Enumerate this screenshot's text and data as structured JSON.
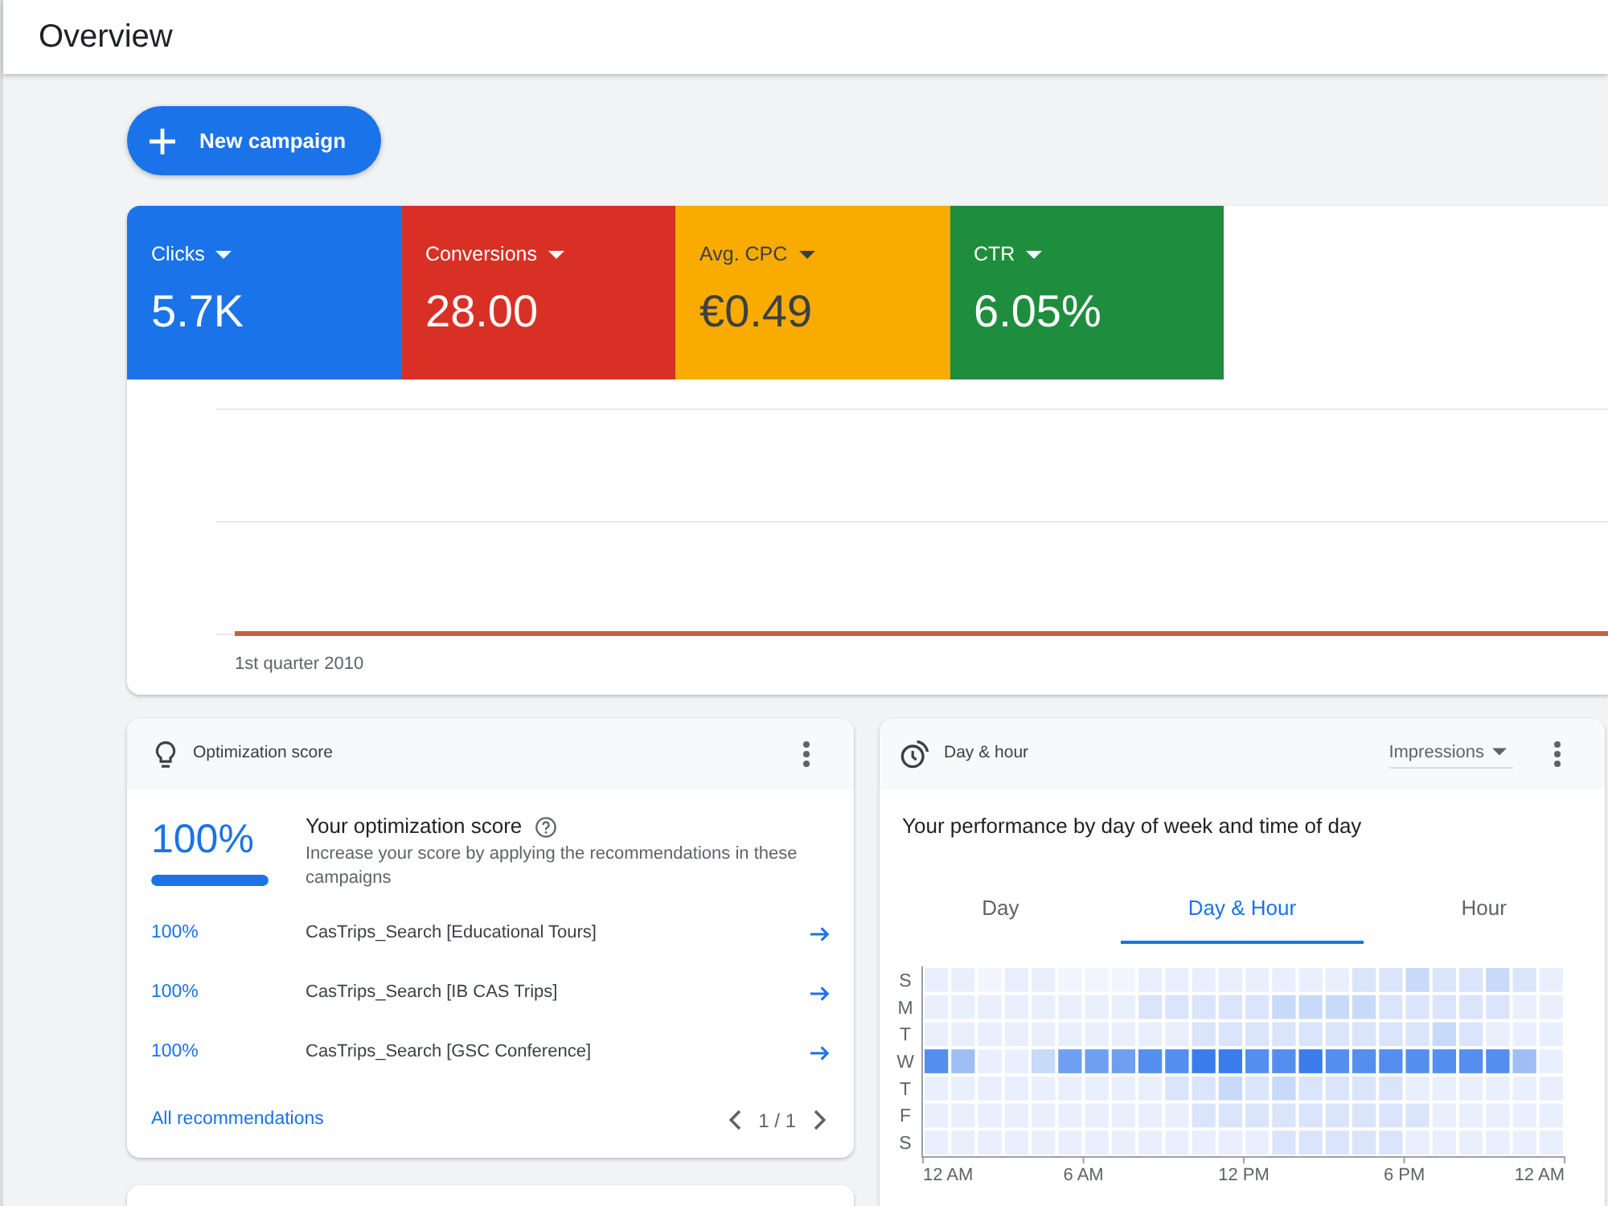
{
  "header": {
    "title": "Overview"
  },
  "new_campaign_button": {
    "label": "New campaign"
  },
  "overview": {
    "metrics": [
      {
        "label": "Clicks",
        "value": "5.7K",
        "color": "#1a73e8"
      },
      {
        "label": "Conversions",
        "value": "28.00",
        "color": "#d93025"
      },
      {
        "label": "Avg. CPC",
        "value": "€0.49",
        "color": "#f9ab00"
      },
      {
        "label": "CTR",
        "value": "6.05%",
        "color": "#1e8e3e"
      }
    ],
    "chart": {
      "x_label": "1st quarter 2010"
    }
  },
  "optimization_card": {
    "title": "Optimization score",
    "score": "100%",
    "level": 1,
    "heading": "Your optimization score",
    "description": "Increase your score by applying the recommendations in these campaigns",
    "campaigns": [
      {
        "score": "100%",
        "name": "CasTrips_Search [Educational Tours]"
      },
      {
        "score": "100%",
        "name": "CasTrips_Search [IB CAS Trips]"
      },
      {
        "score": "100%",
        "name": "CasTrips_Search [GSC Conference]"
      }
    ],
    "link": "All recommendations",
    "pagination": "1 / 1"
  },
  "day_hour_card": {
    "title": "Day & hour",
    "metric": "Impressions",
    "heading": "Your performance by day of week and time of day",
    "tabs": [
      {
        "label": "Day",
        "selected": false
      },
      {
        "label": "Day & Hour",
        "selected": true
      },
      {
        "label": "Hour",
        "selected": false
      }
    ],
    "heatmap": {
      "days": [
        "S",
        "M",
        "T",
        "W",
        "T",
        "F",
        "S"
      ],
      "hours": [
        "12 AM",
        "6 AM",
        "12 PM",
        "6 PM",
        "12 AM"
      ]
    }
  }
}
